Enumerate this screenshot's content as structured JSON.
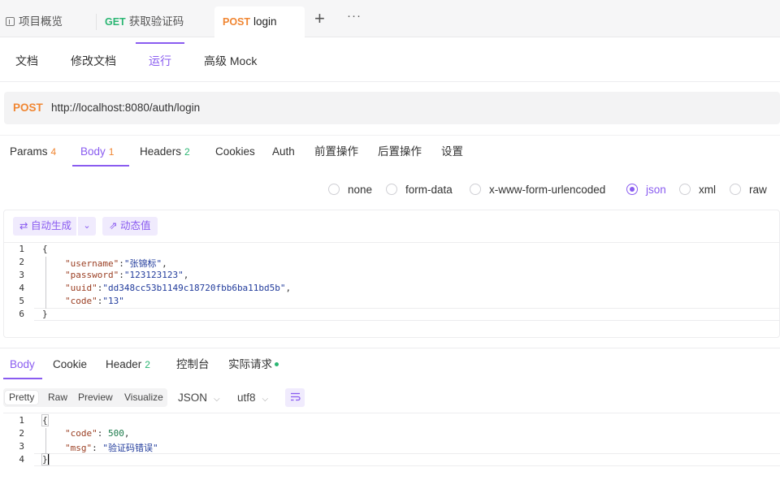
{
  "top_tabs": [
    {
      "method": "",
      "label": "项目概览"
    },
    {
      "method": "GET",
      "label": "获取验证码"
    },
    {
      "method": "POST",
      "label": "login"
    }
  ],
  "top_actions": {
    "add": "+",
    "more": "···"
  },
  "sub_tabs": [
    "文档",
    "修改文档",
    "运行",
    "高级 Mock"
  ],
  "request": {
    "method": "POST",
    "url": "http://localhost:8080/auth/login"
  },
  "param_tabs": [
    {
      "label": "Params",
      "count": "4"
    },
    {
      "label": "Body",
      "count": "1"
    },
    {
      "label": "Headers",
      "count": "2"
    },
    {
      "label": "Cookies",
      "count": ""
    },
    {
      "label": "Auth",
      "count": ""
    },
    {
      "label": "前置操作",
      "count": ""
    },
    {
      "label": "后置操作",
      "count": ""
    },
    {
      "label": "设置",
      "count": ""
    }
  ],
  "body_types": [
    "none",
    "form-data",
    "x-www-form-urlencoded",
    "json",
    "xml",
    "raw"
  ],
  "body_type_selected": "json",
  "editor_buttons": {
    "auto": "⇄ 自动生成",
    "dropdown": "⌄",
    "dynamic": "⇗ 动态值"
  },
  "request_body": {
    "line_numbers": [
      "1",
      "2",
      "3",
      "4",
      "5",
      "6"
    ],
    "open": "{",
    "close": "}",
    "fields": [
      {
        "key": "\"username\"",
        "sep": ":",
        "value": "\"张锦标\"",
        "tail": ","
      },
      {
        "key": "\"password\"",
        "sep": ":",
        "value": "\"123123123\"",
        "tail": ","
      },
      {
        "key": "\"uuid\"",
        "sep": ":",
        "value": "\"dd348cc53b1149c18720fbb6ba11bd5b\"",
        "tail": ","
      },
      {
        "key": "\"code\"",
        "sep": ":",
        "value": "\"13\"",
        "tail": ""
      }
    ]
  },
  "response_tabs": [
    {
      "label": "Body",
      "count": ""
    },
    {
      "label": "Cookie",
      "count": ""
    },
    {
      "label": "Header",
      "count": "2"
    },
    {
      "label": "控制台",
      "count": ""
    },
    {
      "label": "实际请求",
      "count": ""
    }
  ],
  "view_modes": [
    "Pretty",
    "Raw",
    "Preview",
    "Visualize"
  ],
  "format": "JSON",
  "encoding": "utf8",
  "response_body": {
    "line_numbers": [
      "1",
      "2",
      "3",
      "4"
    ],
    "open": "{",
    "close": "}",
    "fields": [
      {
        "key": "\"code\"",
        "sep": ": ",
        "value": "500",
        "tail": ","
      },
      {
        "key": "\"msg\"",
        "sep": ": ",
        "value": "\"验证码错误\"",
        "tail": ""
      }
    ]
  },
  "colors": {
    "accent": "#8a5cf0",
    "post": "#f08632",
    "get": "#2bb673"
  }
}
